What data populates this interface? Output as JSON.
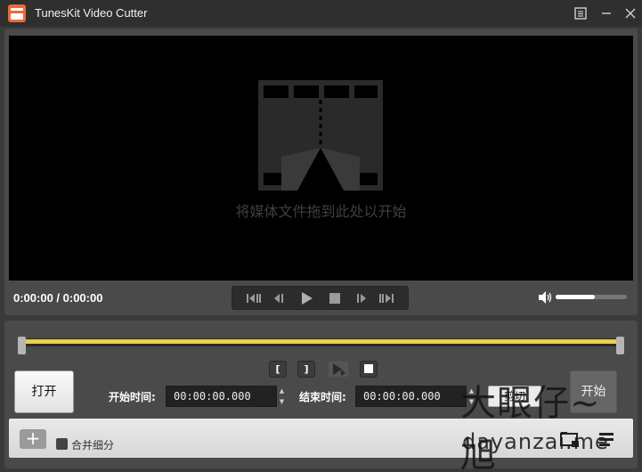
{
  "titlebar": {
    "title": "TunesKit Video Cutter",
    "menu_icon": "menu-icon",
    "minimize_icon": "minimize-icon",
    "close_icon": "close-icon"
  },
  "player": {
    "drop_hint": "将媒体文件拖到此处以开始",
    "time_display": "0:00:00 / 0:00:00",
    "volume": 0.55,
    "controls": [
      "prev-segment-icon",
      "prev-frame-icon",
      "play-icon",
      "stop-icon",
      "next-frame-icon",
      "next-segment-icon"
    ]
  },
  "editor": {
    "timeline_color": "#e7d04a",
    "open_label": "打开",
    "start_time_label": "开始时间:",
    "start_time_value": "00:00:00.000",
    "end_time_label": "结束时间:",
    "end_time_value": "00:00:00.000",
    "cut_label": "剪切",
    "start_label": "开始",
    "merge_label": "合并细分",
    "mark_start": "[",
    "mark_end": "]"
  },
  "watermark": {
    "chinese": "大眼仔~旭",
    "english": "dayanzai.me"
  }
}
